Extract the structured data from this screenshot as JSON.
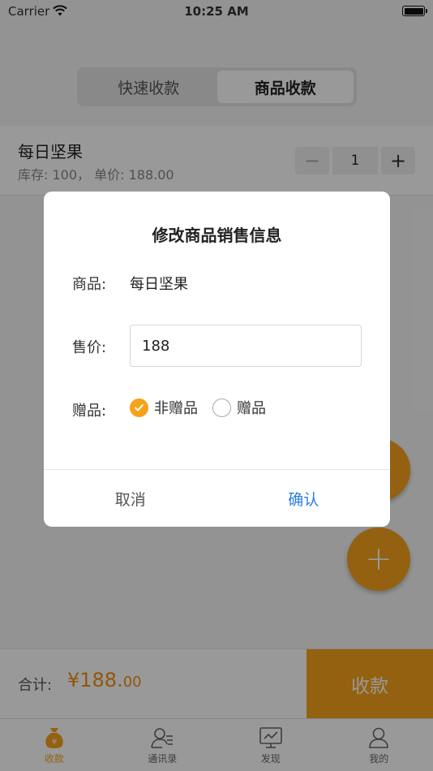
{
  "status_bar": {
    "carrier": "Carrier",
    "time": "10:25 AM"
  },
  "segments": [
    {
      "label": "快速收款",
      "active": false
    },
    {
      "label": "商品收款",
      "active": true
    }
  ],
  "product": {
    "name": "每日坚果",
    "meta": "库存: 100， 单价: 188.00",
    "stepper": {
      "minus": "−",
      "qty": "1",
      "plus": "+"
    }
  },
  "fab_add_label": "+",
  "bottom": {
    "total_label": "合计:",
    "total_integer": "¥188.",
    "total_decimal": "00",
    "collect_label": "收款"
  },
  "tabs": [
    {
      "label": "收款",
      "icon": "money-bag-icon",
      "active": true
    },
    {
      "label": "通讯录",
      "icon": "contacts-icon",
      "active": false
    },
    {
      "label": "发现",
      "icon": "monitor-icon",
      "active": false
    },
    {
      "label": "我的",
      "icon": "person-icon",
      "active": false
    }
  ],
  "dialog": {
    "title": "修改商品销售信息",
    "product_label": "商品:",
    "product_value": "每日坚果",
    "price_label": "售价:",
    "price_value": "188",
    "gift_label": "赠品:",
    "gift_options": [
      {
        "label": "非赠品",
        "checked": true
      },
      {
        "label": "赠品",
        "checked": false
      }
    ],
    "cancel_label": "取消",
    "confirm_label": "确认"
  },
  "colors": {
    "accent": "#f7a21b",
    "confirm": "#2a7de1",
    "total": "#f29013"
  }
}
